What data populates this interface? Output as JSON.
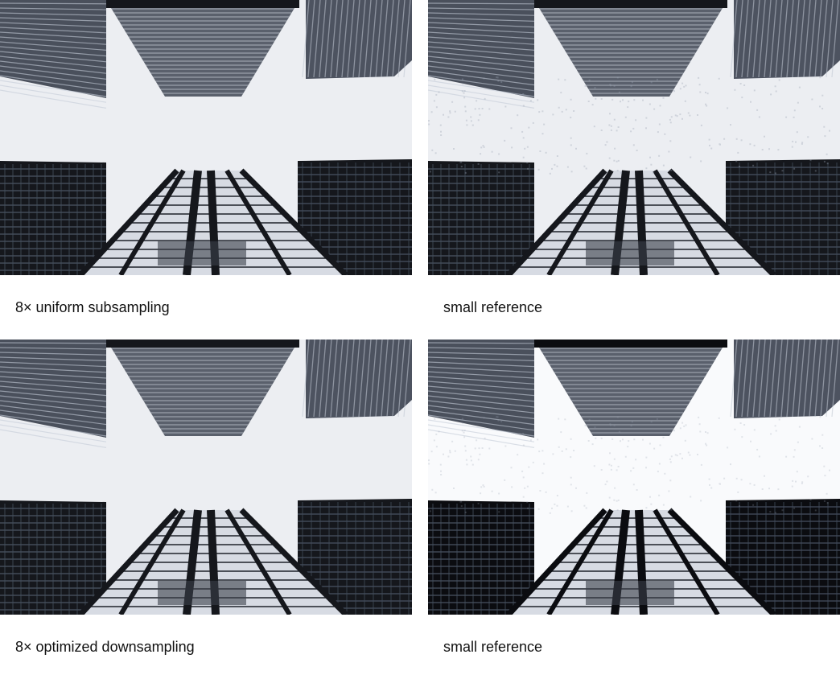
{
  "panels": [
    {
      "id": "uniform",
      "caption": "8× uniform subsampling",
      "variant": "uniform"
    },
    {
      "id": "ref-top",
      "caption": "small reference",
      "variant": "reference"
    },
    {
      "id": "optimized",
      "caption": "8× optimized downsampling",
      "variant": "optimized"
    },
    {
      "id": "ref-bottom",
      "caption": "small reference",
      "variant": "reference-contrast"
    }
  ],
  "colors": {
    "sky": "#eceef2",
    "sky_bright": "#f9fafc",
    "facade_dark": "#15171c",
    "facade_mid": "#3a3f4a",
    "window_light": "#b8bfcc",
    "glass_pale": "#d7dbe3"
  }
}
